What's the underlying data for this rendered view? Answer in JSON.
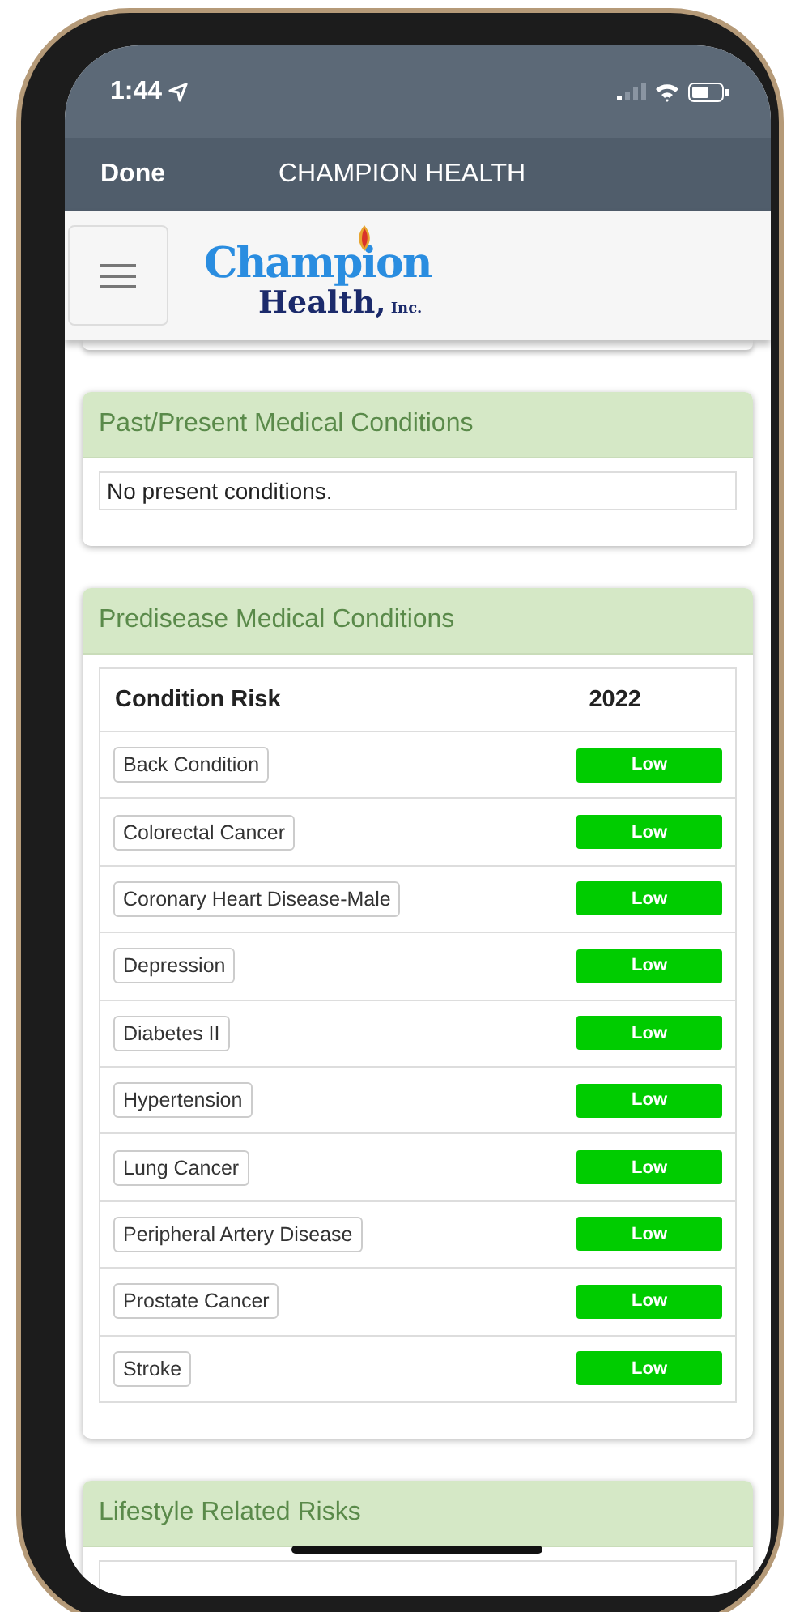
{
  "status_bar": {
    "time": "1:44"
  },
  "nav_bar": {
    "done": "Done",
    "title": "CHAMPION HEALTH"
  },
  "logo": {
    "name": "Champion",
    "line2": "Health,",
    "suffix": "Inc."
  },
  "sections": [
    {
      "title": "Past/Present Medical Conditions",
      "kind": "note",
      "note": "No present conditions."
    },
    {
      "title": "Predisease Medical Conditions",
      "kind": "table",
      "columns": [
        "Condition Risk",
        "2022"
      ],
      "rows": [
        {
          "condition": "Back Condition",
          "risk": "Low",
          "color": "#00cc00"
        },
        {
          "condition": "Colorectal Cancer",
          "risk": "Low",
          "color": "#00cc00"
        },
        {
          "condition": "Coronary Heart Disease-Male",
          "risk": "Low",
          "color": "#00cc00"
        },
        {
          "condition": "Depression",
          "risk": "Low",
          "color": "#00cc00"
        },
        {
          "condition": "Diabetes II",
          "risk": "Low",
          "color": "#00cc00"
        },
        {
          "condition": "Hypertension",
          "risk": "Low",
          "color": "#00cc00"
        },
        {
          "condition": "Lung Cancer",
          "risk": "Low",
          "color": "#00cc00"
        },
        {
          "condition": "Peripheral Artery Disease",
          "risk": "Low",
          "color": "#00cc00"
        },
        {
          "condition": "Prostate Cancer",
          "risk": "Low",
          "color": "#00cc00"
        },
        {
          "condition": "Stroke",
          "risk": "Low",
          "color": "#00cc00"
        }
      ]
    },
    {
      "title": "Lifestyle Related Risks",
      "kind": "table"
    }
  ]
}
